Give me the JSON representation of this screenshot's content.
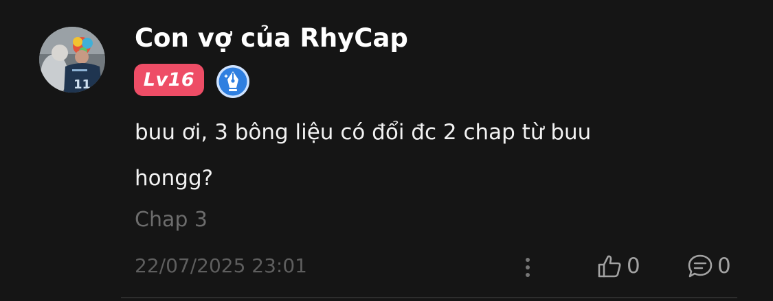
{
  "comment": {
    "username": "Con vợ của RhyCap",
    "level": "Lv16",
    "body": "buu ơi, 3 bông liệu có đổi đc 2 chap từ buu hongg?",
    "chapter": "Chap 3",
    "timestamp": "22/07/2025 23:01",
    "like_count": "0",
    "reply_count": "0"
  },
  "icons": {
    "more": "more-vertical-icon",
    "like": "thumbs-up-icon",
    "reply": "chat-bubble-icon",
    "writer_badge": "pen-nib-icon"
  },
  "colors": {
    "background": "#151515",
    "level_badge": "#ee4d66",
    "writer_badge": "#2f7fe0",
    "muted_text": "#6c6c6c"
  }
}
